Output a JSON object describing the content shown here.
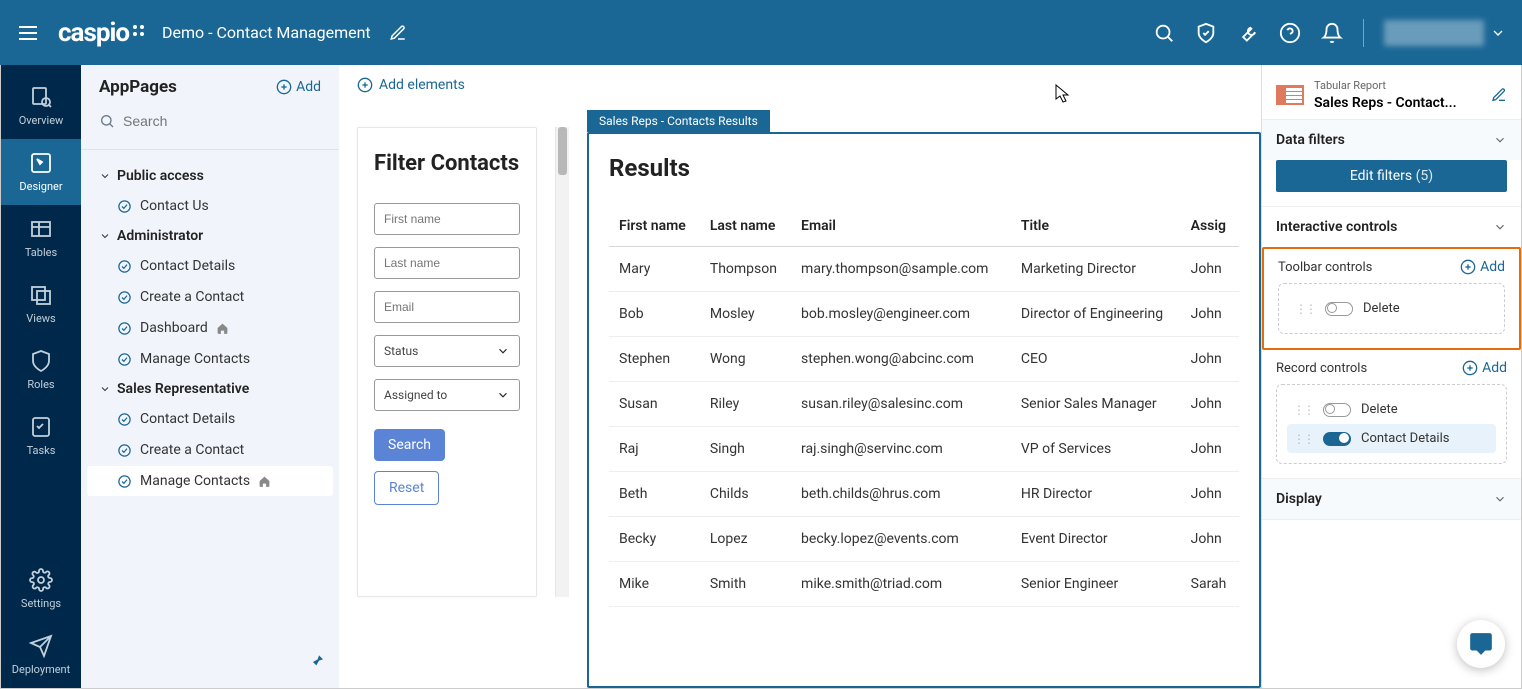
{
  "header": {
    "logo": "caspio",
    "breadcrumb": "Demo - Contact Management"
  },
  "rail": {
    "items": [
      {
        "label": "Overview",
        "icon": "page-search"
      },
      {
        "label": "Designer",
        "icon": "cursor-box",
        "active": true
      },
      {
        "label": "Tables",
        "icon": "table"
      },
      {
        "label": "Views",
        "icon": "views"
      },
      {
        "label": "Roles",
        "icon": "shield"
      },
      {
        "label": "Tasks",
        "icon": "checklist"
      }
    ],
    "bottom": [
      {
        "label": "Settings",
        "icon": "gear"
      },
      {
        "label": "Deployment",
        "icon": "send"
      }
    ]
  },
  "sidebar": {
    "title": "AppPages",
    "add": "Add",
    "search_ph": "Search",
    "groups": [
      {
        "label": "Public access",
        "items": [
          {
            "label": "Contact Us"
          }
        ]
      },
      {
        "label": "Administrator",
        "items": [
          {
            "label": "Contact Details"
          },
          {
            "label": "Create a Contact"
          },
          {
            "label": "Dashboard",
            "home": true
          },
          {
            "label": "Manage Contacts"
          }
        ]
      },
      {
        "label": "Sales Representative",
        "items": [
          {
            "label": "Contact Details"
          },
          {
            "label": "Create a Contact"
          },
          {
            "label": "Manage Contacts",
            "home": true,
            "active": true
          }
        ]
      }
    ]
  },
  "canvas": {
    "add_elements": "Add elements",
    "filter": {
      "title": "Filter Contacts",
      "first_ph": "First name",
      "last_ph": "Last name",
      "email_ph": "Email",
      "status": "Status",
      "assigned": "Assigned to",
      "search": "Search",
      "reset": "Reset"
    },
    "results": {
      "tab": "Sales Reps - Contacts Results",
      "title": "Results",
      "cols": [
        "First name",
        "Last name",
        "Email",
        "Title",
        "Assig"
      ],
      "rows": [
        [
          "Mary",
          "Thompson",
          "mary.thompson@sample.com",
          "Marketing Director",
          "John "
        ],
        [
          "Bob",
          "Mosley",
          "bob.mosley@engineer.com",
          "Director of Engineering",
          "John "
        ],
        [
          "Stephen",
          "Wong",
          "stephen.wong@abcinc.com",
          "CEO",
          "John "
        ],
        [
          "Susan",
          "Riley",
          "susan.riley@salesinc.com",
          "Senior Sales Manager",
          "John "
        ],
        [
          "Raj",
          "Singh",
          "raj.singh@servinc.com",
          "VP of Services",
          "John "
        ],
        [
          "Beth",
          "Childs",
          "beth.childs@hrus.com",
          "HR Director",
          "John "
        ],
        [
          "Becky",
          "Lopez",
          "becky.lopez@events.com",
          "Event Director",
          "John "
        ],
        [
          "Mike",
          "Smith",
          "mike.smith@triad.com",
          "Senior Engineer",
          "Sarah"
        ]
      ]
    }
  },
  "rpanel": {
    "type": "Tabular Report",
    "name": "Sales Reps - Contact...",
    "sections": {
      "data_filters": "Data filters",
      "edit_filters": "Edit filters",
      "edit_filters_count": "(5)",
      "interactive": "Interactive controls",
      "toolbar": "Toolbar controls",
      "toolbar_items": [
        {
          "label": "Delete",
          "on": false
        }
      ],
      "record": "Record controls",
      "record_items": [
        {
          "label": "Delete",
          "on": false
        },
        {
          "label": "Contact Details",
          "on": true
        }
      ],
      "display": "Display",
      "add": "Add"
    }
  }
}
